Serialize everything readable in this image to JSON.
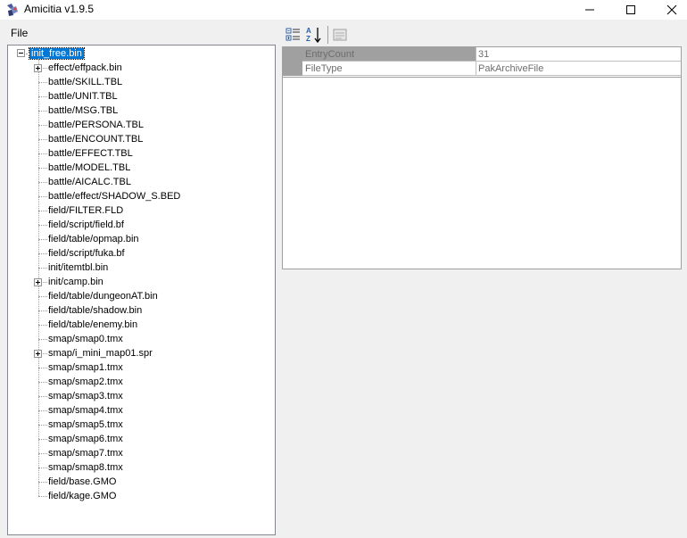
{
  "window": {
    "title": "Amicitia v1.9.5",
    "icon": "app-logo-icon"
  },
  "menu": {
    "items": [
      {
        "label": "File"
      }
    ]
  },
  "tree": {
    "root": "init_free.bin",
    "children": [
      {
        "label": "effect/effpack.bin",
        "expandable": true
      },
      {
        "label": "battle/SKILL.TBL",
        "expandable": false
      },
      {
        "label": "battle/UNIT.TBL",
        "expandable": false
      },
      {
        "label": "battle/MSG.TBL",
        "expandable": false
      },
      {
        "label": "battle/PERSONA.TBL",
        "expandable": false
      },
      {
        "label": "battle/ENCOUNT.TBL",
        "expandable": false
      },
      {
        "label": "battle/EFFECT.TBL",
        "expandable": false
      },
      {
        "label": "battle/MODEL.TBL",
        "expandable": false
      },
      {
        "label": "battle/AICALC.TBL",
        "expandable": false
      },
      {
        "label": "battle/effect/SHADOW_S.BED",
        "expandable": false
      },
      {
        "label": "field/FILTER.FLD",
        "expandable": false
      },
      {
        "label": "field/script/field.bf",
        "expandable": false
      },
      {
        "label": "field/table/opmap.bin",
        "expandable": false
      },
      {
        "label": "field/script/fuka.bf",
        "expandable": false
      },
      {
        "label": "init/itemtbl.bin",
        "expandable": false
      },
      {
        "label": "init/camp.bin",
        "expandable": true
      },
      {
        "label": "field/table/dungeonAT.bin",
        "expandable": false
      },
      {
        "label": "field/table/shadow.bin",
        "expandable": false
      },
      {
        "label": "field/table/enemy.bin",
        "expandable": false
      },
      {
        "label": "smap/smap0.tmx",
        "expandable": false
      },
      {
        "label": "smap/i_mini_map01.spr",
        "expandable": true
      },
      {
        "label": "smap/smap1.tmx",
        "expandable": false
      },
      {
        "label": "smap/smap2.tmx",
        "expandable": false
      },
      {
        "label": "smap/smap3.tmx",
        "expandable": false
      },
      {
        "label": "smap/smap4.tmx",
        "expandable": false
      },
      {
        "label": "smap/smap5.tmx",
        "expandable": false
      },
      {
        "label": "smap/smap6.tmx",
        "expandable": false
      },
      {
        "label": "smap/smap7.tmx",
        "expandable": false
      },
      {
        "label": "smap/smap8.tmx",
        "expandable": false
      },
      {
        "label": "field/base.GMO",
        "expandable": false
      },
      {
        "label": "field/kage.GMO",
        "expandable": false
      }
    ]
  },
  "property_grid": {
    "toolbar": {
      "categorized_icon": "categorized-icon",
      "alphabetical_icon": "sort-alphabetical-icon",
      "property_pages_icon": "property-pages-icon"
    },
    "rows": [
      {
        "name": "EntryCount",
        "value": "31",
        "selected": true
      },
      {
        "name": "FileType",
        "value": "PakArchiveFile",
        "selected": false
      }
    ]
  },
  "colors": {
    "selection": "#0078d7",
    "window_bg": "#f0f0f0",
    "grid_margin": "#a0a0a0"
  }
}
